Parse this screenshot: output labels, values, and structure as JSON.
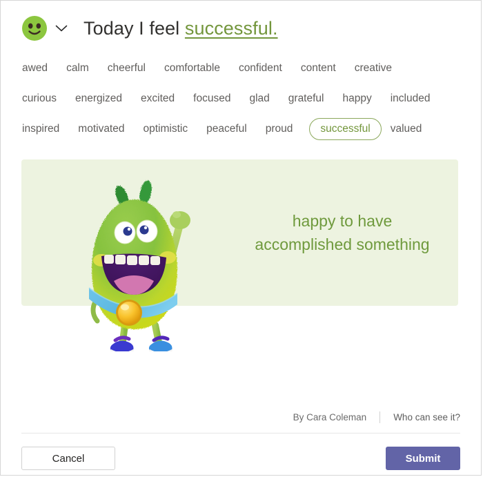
{
  "dialog": {
    "accent_green": "#73963c",
    "banner_bg": "#edf3e0",
    "submit_purple": "#6264a7"
  },
  "header": {
    "avatar_icon": "green-smiley-face-icon",
    "chevron_icon": "chevron-down-icon",
    "prefix": "Today I feel ",
    "feeling_word": "successful."
  },
  "words": {
    "selected": "successful",
    "items": [
      {
        "label": "awed",
        "selected": false
      },
      {
        "label": "calm",
        "selected": false
      },
      {
        "label": "cheerful",
        "selected": false
      },
      {
        "label": "comfortable",
        "selected": false
      },
      {
        "label": "confident",
        "selected": false
      },
      {
        "label": "content",
        "selected": false
      },
      {
        "label": "creative",
        "selected": false
      },
      {
        "label": "curious",
        "selected": false
      },
      {
        "label": "energized",
        "selected": false
      },
      {
        "label": "excited",
        "selected": false
      },
      {
        "label": "focused",
        "selected": false
      },
      {
        "label": "glad",
        "selected": false
      },
      {
        "label": "grateful",
        "selected": false
      },
      {
        "label": "happy",
        "selected": false
      },
      {
        "label": "included",
        "selected": false
      },
      {
        "label": "inspired",
        "selected": false
      },
      {
        "label": "motivated",
        "selected": false
      },
      {
        "label": "optimistic",
        "selected": false
      },
      {
        "label": "peaceful",
        "selected": false
      },
      {
        "label": "proud",
        "selected": false
      },
      {
        "label": "successful",
        "selected": true
      },
      {
        "label": "valued",
        "selected": false
      }
    ]
  },
  "banner": {
    "line1": "happy to have",
    "line2": "accomplished something",
    "illustration": "green-furry-monster-mascot-illustration"
  },
  "byline": {
    "author": "By Cara Coleman",
    "visibility_link": "Who can see it?"
  },
  "footer": {
    "cancel_label": "Cancel",
    "submit_label": "Submit"
  }
}
